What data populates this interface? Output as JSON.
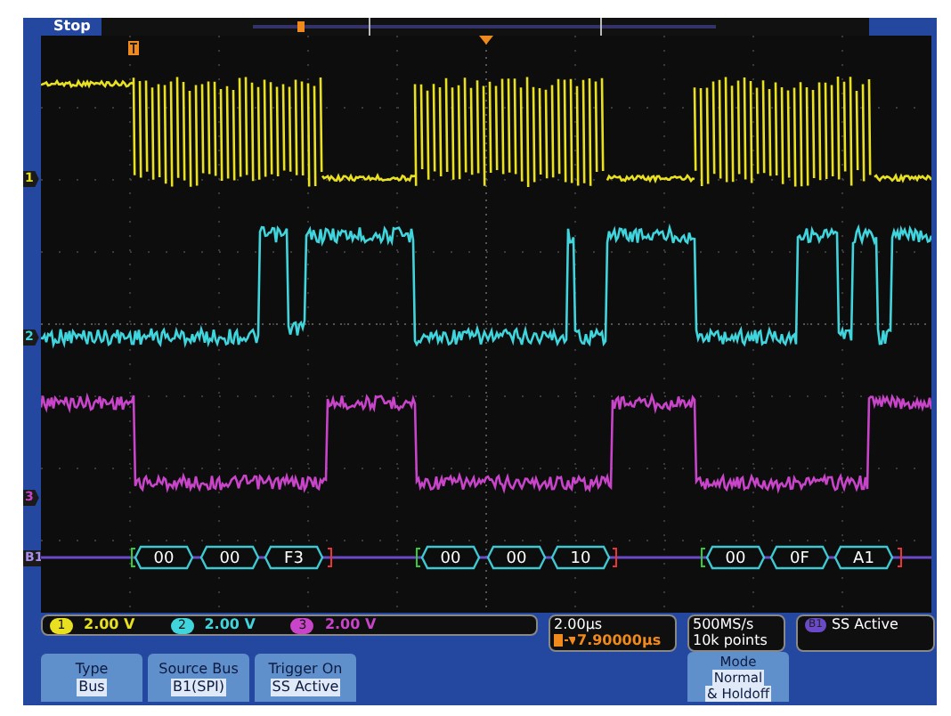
{
  "status": "Stop",
  "channels": [
    {
      "marker": "1",
      "badge": "1",
      "scale": "2.00 V",
      "color": "#e8e020"
    },
    {
      "marker": "2",
      "badge": "2",
      "scale": "2.00 V",
      "color": "#40d4dc"
    },
    {
      "marker": "3",
      "badge": "3",
      "scale": "2.00 V",
      "color": "#c844c8"
    }
  ],
  "bus": {
    "marker": "B1",
    "packets": [
      {
        "values": [
          "00",
          "00",
          "F3"
        ]
      },
      {
        "values": [
          "00",
          "00",
          "10"
        ]
      },
      {
        "values": [
          "00",
          "0F",
          "A1"
        ]
      }
    ]
  },
  "timebase": {
    "scale": "2.00µs",
    "delay": "7.90000µs"
  },
  "acquisition": {
    "rate": "500MS/s",
    "record": "10k points"
  },
  "trigger_status": {
    "source": "B1",
    "text": "SS Active"
  },
  "menu": [
    {
      "title": "Type",
      "value": "Bus"
    },
    {
      "title": "Source Bus",
      "value": "B1",
      "suffix": "(SPI)"
    },
    {
      "title": "Trigger On",
      "value": "SS Active"
    }
  ],
  "side_button": {
    "title": "Mode",
    "lines": [
      "Normal",
      "& Holdoff"
    ]
  }
}
